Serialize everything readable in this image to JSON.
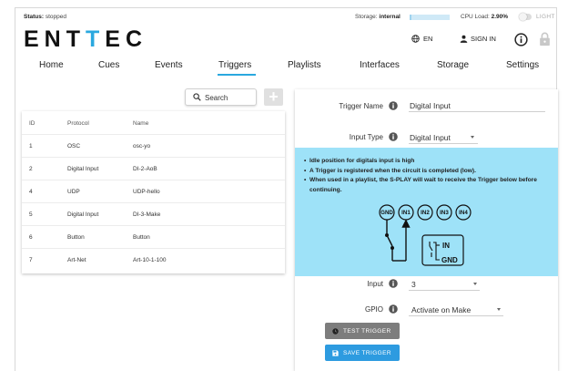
{
  "status": {
    "label": "Status:",
    "value": "stopped"
  },
  "storage": {
    "label": "Storage:",
    "value": "internal",
    "used_fraction": 0.05
  },
  "cpu": {
    "label": "CPU Load:",
    "value": "2.90%"
  },
  "theme": {
    "label": "LIGHT"
  },
  "logo": {
    "part1": "ENT",
    "part2": "T",
    "part3": "EC"
  },
  "header": {
    "language": "EN",
    "signin": "SIGN IN"
  },
  "nav": {
    "tabs": [
      {
        "label": "Home"
      },
      {
        "label": "Cues"
      },
      {
        "label": "Events"
      },
      {
        "label": "Triggers"
      },
      {
        "label": "Playlists"
      },
      {
        "label": "Interfaces"
      },
      {
        "label": "Storage"
      },
      {
        "label": "Settings"
      }
    ],
    "active": "Triggers"
  },
  "search": {
    "label": "Search"
  },
  "add": {
    "label": "+"
  },
  "table": {
    "headers": {
      "id": "ID",
      "protocol": "Protocol",
      "name": "Name"
    },
    "rows": [
      {
        "id": "1",
        "protocol": "OSC",
        "name": "osc-yo"
      },
      {
        "id": "2",
        "protocol": "Digital Input",
        "name": "DI-2-AoB"
      },
      {
        "id": "4",
        "protocol": "UDP",
        "name": "UDP-hello"
      },
      {
        "id": "5",
        "protocol": "Digital Input",
        "name": "DI-3-Make"
      },
      {
        "id": "6",
        "protocol": "Button",
        "name": "Button"
      },
      {
        "id": "7",
        "protocol": "Art-Net",
        "name": "Art-10-1-100"
      }
    ]
  },
  "form": {
    "trigger_name": {
      "label": "Trigger Name",
      "value": "Digital Input"
    },
    "input_type": {
      "label": "Input Type",
      "value": "Digital Input"
    },
    "info": [
      "Idle position for digitals input is high",
      "A Trigger is registered when the circuit is completed (low).",
      "When used in a playlist, the S-PLAY will wait to receive the Trigger below before continuing."
    ],
    "diagram": {
      "pins": [
        "GND",
        "IN1",
        "IN2",
        "IN3",
        "IN4"
      ],
      "legend_in": "IN",
      "legend_gnd": "GND"
    },
    "input": {
      "label": "Input",
      "value": "3"
    },
    "gpio": {
      "label": "GPIO",
      "value": "Activate on Make"
    },
    "test_button": "TEST TRIGGER",
    "save_button": "SAVE TRIGGER"
  }
}
